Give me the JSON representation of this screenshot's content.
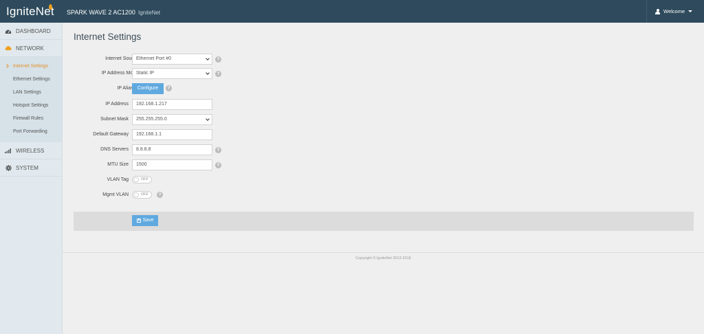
{
  "header": {
    "logo_text": "IgniteNet",
    "device_name": "SPARK WAVE 2 AC1200",
    "device_owner": "IgniteNet",
    "welcome_label": "Welcome"
  },
  "sidebar": {
    "items": [
      {
        "label": "DASHBOARD",
        "icon": "dashboard-icon"
      },
      {
        "label": "NETWORK",
        "icon": "cloud-icon"
      },
      {
        "label": "WIRELESS",
        "icon": "signal-bars-icon"
      },
      {
        "label": "SYSTEM",
        "icon": "gear-icon"
      }
    ],
    "network_submenu": [
      {
        "label": "Internet Settings",
        "active": true
      },
      {
        "label": "Ethernet Settings"
      },
      {
        "label": "LAN Settings"
      },
      {
        "label": "Hotspot Settings"
      },
      {
        "label": "Firewall Rules"
      },
      {
        "label": "Port Forwarding"
      }
    ]
  },
  "main": {
    "title": "Internet Settings",
    "form": {
      "internet_source": {
        "label": "Internet Source",
        "value": "Ethernet Port #0"
      },
      "ip_mode": {
        "label": "IP Address Mode",
        "value": "Static IP"
      },
      "ip_aliases": {
        "label": "IP Aliases",
        "button": "Configure"
      },
      "ip_address": {
        "label": "IP Address",
        "value": "192.168.1.217"
      },
      "subnet_mask": {
        "label": "Subnet Mask",
        "value": "255.255.255.0"
      },
      "gateway": {
        "label": "Default Gateway",
        "value": "192.168.1.1"
      },
      "dns": {
        "label": "DNS Servers",
        "value": "8.8.8.8"
      },
      "mtu": {
        "label": "MTU Size",
        "value": "1500"
      },
      "vlan_tag": {
        "label": "VLAN Tag",
        "state": "OFF"
      },
      "mgmt_vlan": {
        "label": "Mgmt VLAN",
        "state": "OFF"
      }
    },
    "help_glyph": "?",
    "save_label": "Save"
  },
  "footer": {
    "copyright": "Copyright © IgniteNet 2013-2018"
  },
  "colors": {
    "header_bg": "#2e4a5c",
    "accent_orange": "#e3922a",
    "button_blue": "#5fa9df"
  }
}
